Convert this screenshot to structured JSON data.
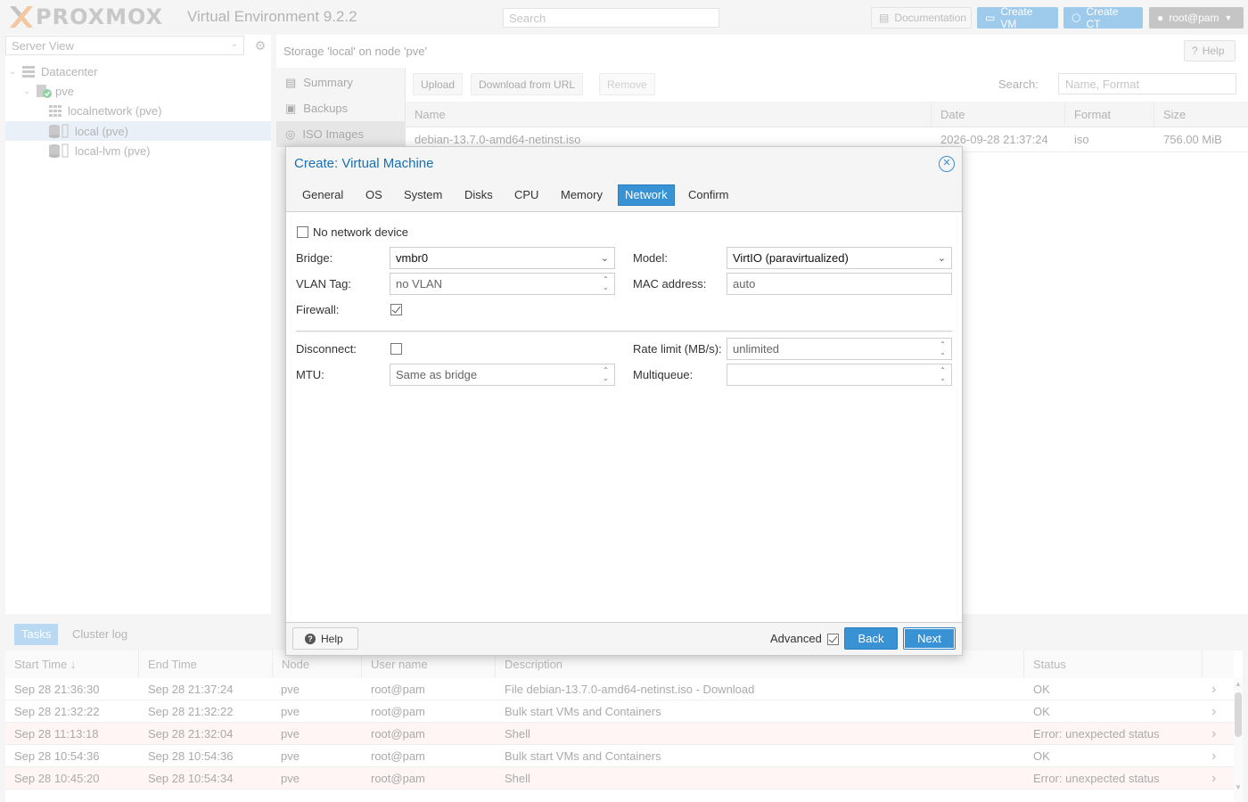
{
  "header": {
    "logo_text": "PROXMOX",
    "version": "Virtual Environment 9.2.2",
    "search_placeholder": "Search",
    "documentation": "Documentation",
    "create_vm": "Create VM",
    "create_ct": "Create CT",
    "user": "root@pam"
  },
  "tree": {
    "view": "Server View",
    "items": [
      {
        "label": "Datacenter",
        "icon": "datacenter-icon"
      },
      {
        "label": "pve",
        "icon": "node-online-icon"
      },
      {
        "label": "localnetwork (pve)",
        "icon": "sdn-zone-icon"
      },
      {
        "label": "local (pve)",
        "icon": "storage-icon",
        "selected": true
      },
      {
        "label": "local-lvm (pve)",
        "icon": "storage-icon"
      }
    ]
  },
  "content": {
    "title": "Storage 'local' on node 'pve'",
    "help": "Help",
    "nav": [
      "Summary",
      "Backups",
      "ISO Images"
    ],
    "toolbar": {
      "upload": "Upload",
      "download_url": "Download from URL",
      "remove": "Remove",
      "search_label": "Search:",
      "search_placeholder": "Name, Format"
    },
    "columns": [
      "Name",
      "Date",
      "Format",
      "Size"
    ],
    "rows": [
      {
        "name": "debian-13.7.0-amd64-netinst.iso",
        "date": "2026-09-28 21:37:24",
        "format": "iso",
        "size": "756.00 MiB"
      }
    ]
  },
  "tasks": {
    "tabs": [
      "Tasks",
      "Cluster log"
    ],
    "columns": [
      "Start Time",
      "End Time",
      "Node",
      "User name",
      "Description",
      "Status"
    ],
    "sort_indicator": "↓",
    "rows": [
      {
        "start": "Sep 28 21:36:30",
        "end": "Sep 28 21:37:24",
        "node": "pve",
        "user": "root@pam",
        "desc": "File debian-13.7.0-amd64-netinst.iso - Download",
        "status": "OK"
      },
      {
        "start": "Sep 28 21:32:22",
        "end": "Sep 28 21:32:22",
        "node": "pve",
        "user": "root@pam",
        "desc": "Bulk start VMs and Containers",
        "status": "OK"
      },
      {
        "start": "Sep 28 11:13:18",
        "end": "Sep 28 21:32:04",
        "node": "pve",
        "user": "root@pam",
        "desc": "Shell",
        "status": "Error: unexpected status"
      },
      {
        "start": "Sep 28 10:54:36",
        "end": "Sep 28 10:54:36",
        "node": "pve",
        "user": "root@pam",
        "desc": "Bulk start VMs and Containers",
        "status": "OK"
      },
      {
        "start": "Sep 28 10:45:20",
        "end": "Sep 28 10:54:34",
        "node": "pve",
        "user": "root@pam",
        "desc": "Shell",
        "status": "Error: unexpected status"
      }
    ]
  },
  "dialog": {
    "title": "Create: Virtual Machine",
    "tabs": [
      "General",
      "OS",
      "System",
      "Disks",
      "CPU",
      "Memory",
      "Network",
      "Confirm"
    ],
    "active_tab": "Network",
    "no_network_label": "No network device",
    "no_network_checked": false,
    "bridge_label": "Bridge:",
    "bridge_value": "vmbr0",
    "vlan_label": "VLAN Tag:",
    "vlan_value": "no VLAN",
    "firewall_label": "Firewall:",
    "firewall_checked": true,
    "model_label": "Model:",
    "model_value": "VirtIO (paravirtualized)",
    "mac_label": "MAC address:",
    "mac_value": "auto",
    "disconnect_label": "Disconnect:",
    "disconnect_checked": false,
    "mtu_label": "MTU:",
    "mtu_value": "Same as bridge",
    "rate_label": "Rate limit (MB/s):",
    "rate_value": "unlimited",
    "multiqueue_label": "Multiqueue:",
    "multiqueue_value": "",
    "help": "Help",
    "advanced_label": "Advanced",
    "advanced_checked": true,
    "back": "Back",
    "next": "Next"
  },
  "colors": {
    "accent": "#3892d4",
    "title": "#1a6fb3",
    "selection": "#e9f0f7",
    "error_row": "#fff5f5"
  }
}
